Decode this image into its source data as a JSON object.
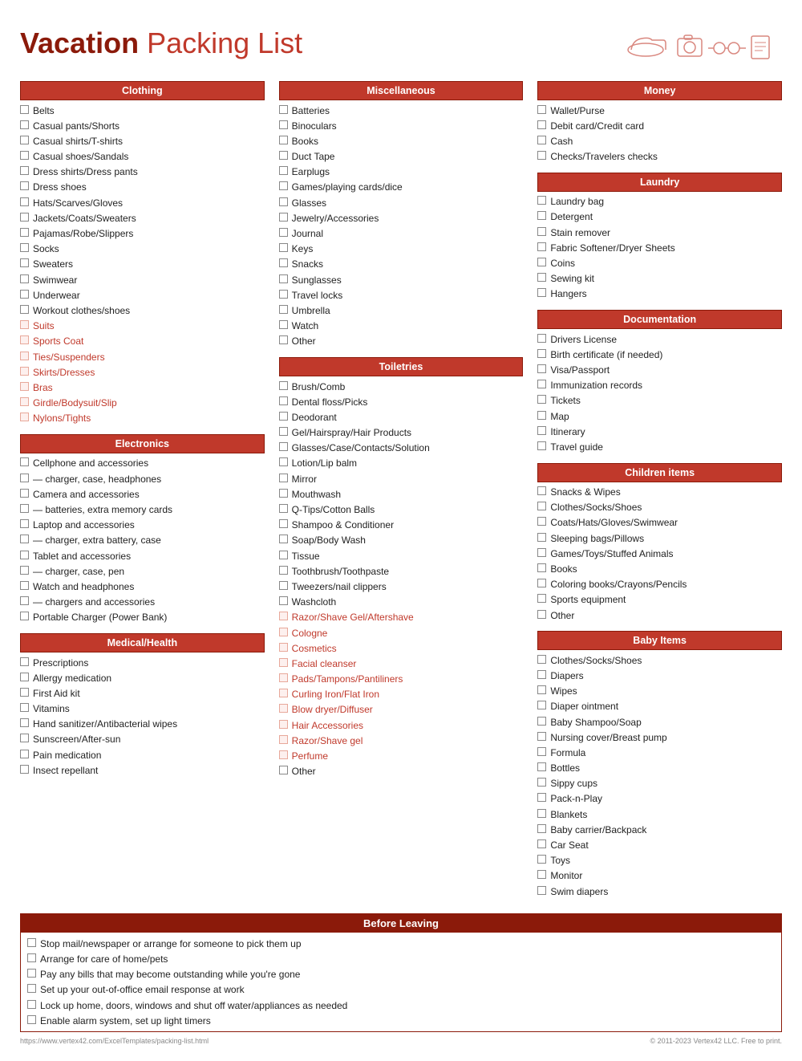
{
  "header": {
    "title_bold": "Vacation",
    "title_rest": " Packing List",
    "icons": "✈ 👟 📷 👓"
  },
  "columns": [
    {
      "sections": [
        {
          "id": "clothing",
          "label": "Clothing",
          "style": "dark",
          "items": [
            {
              "text": "Belts",
              "pink": false
            },
            {
              "text": "Casual pants/Shorts",
              "pink": false
            },
            {
              "text": "Casual shirts/T-shirts",
              "pink": false
            },
            {
              "text": "Casual shoes/Sandals",
              "pink": false
            },
            {
              "text": "Dress shirts/Dress pants",
              "pink": false
            },
            {
              "text": "Dress shoes",
              "pink": false
            },
            {
              "text": "Hats/Scarves/Gloves",
              "pink": false
            },
            {
              "text": "Jackets/Coats/Sweaters",
              "pink": false
            },
            {
              "text": "Pajamas/Robe/Slippers",
              "pink": false
            },
            {
              "text": "Socks",
              "pink": false
            },
            {
              "text": "Sweaters",
              "pink": false
            },
            {
              "text": "Swimwear",
              "pink": false
            },
            {
              "text": "Underwear",
              "pink": false
            },
            {
              "text": "Workout clothes/shoes",
              "pink": false
            },
            {
              "text": "Suits",
              "pink": true
            },
            {
              "text": "Sports Coat",
              "pink": true
            },
            {
              "text": "Ties/Suspenders",
              "pink": true
            },
            {
              "text": "Skirts/Dresses",
              "pink": true
            },
            {
              "text": "Bras",
              "pink": true
            },
            {
              "text": "Girdle/Bodysuit/Slip",
              "pink": true
            },
            {
              "text": "Nylons/Tights",
              "pink": true
            }
          ]
        },
        {
          "id": "electronics",
          "label": "Electronics",
          "style": "dark",
          "items": [
            {
              "text": "Cellphone and accessories",
              "pink": false
            },
            {
              "text": "— charger, case, headphones",
              "pink": false
            },
            {
              "text": "Camera and accessories",
              "pink": false
            },
            {
              "text": "— batteries, extra memory cards",
              "pink": false
            },
            {
              "text": "Laptop and accessories",
              "pink": false
            },
            {
              "text": "— charger, extra battery, case",
              "pink": false
            },
            {
              "text": "Tablet and accessories",
              "pink": false
            },
            {
              "text": "— charger, case, pen",
              "pink": false
            },
            {
              "text": "Watch and headphones",
              "pink": false
            },
            {
              "text": "— chargers and accessories",
              "pink": false
            },
            {
              "text": "Portable Charger (Power Bank)",
              "pink": false
            }
          ]
        },
        {
          "id": "medical",
          "label": "Medical/Health",
          "style": "dark",
          "items": [
            {
              "text": "Prescriptions",
              "pink": false
            },
            {
              "text": "Allergy medication",
              "pink": false
            },
            {
              "text": "First Aid kit",
              "pink": false
            },
            {
              "text": "Vitamins",
              "pink": false
            },
            {
              "text": "Hand sanitizer/Antibacterial wipes",
              "pink": false
            },
            {
              "text": "Sunscreen/After-sun",
              "pink": false
            },
            {
              "text": "Pain medication",
              "pink": false
            },
            {
              "text": "Insect repellant",
              "pink": false
            }
          ]
        }
      ]
    },
    {
      "sections": [
        {
          "id": "miscellaneous",
          "label": "Miscellaneous",
          "style": "dark",
          "items": [
            {
              "text": "Batteries",
              "pink": false
            },
            {
              "text": "Binoculars",
              "pink": false
            },
            {
              "text": "Books",
              "pink": false
            },
            {
              "text": "Duct Tape",
              "pink": false
            },
            {
              "text": "Earplugs",
              "pink": false
            },
            {
              "text": "Games/playing cards/dice",
              "pink": false
            },
            {
              "text": "Glasses",
              "pink": false
            },
            {
              "text": "Jewelry/Accessories",
              "pink": false
            },
            {
              "text": "Journal",
              "pink": false
            },
            {
              "text": "Keys",
              "pink": false
            },
            {
              "text": "Snacks",
              "pink": false
            },
            {
              "text": "Sunglasses",
              "pink": false
            },
            {
              "text": "Travel locks",
              "pink": false
            },
            {
              "text": "Umbrella",
              "pink": false
            },
            {
              "text": "Watch",
              "pink": false
            },
            {
              "text": "Other",
              "pink": false
            }
          ]
        },
        {
          "id": "toiletries",
          "label": "Toiletries",
          "style": "dark",
          "items": [
            {
              "text": "Brush/Comb",
              "pink": false
            },
            {
              "text": "Dental floss/Picks",
              "pink": false
            },
            {
              "text": "Deodorant",
              "pink": false
            },
            {
              "text": "Gel/Hairspray/Hair Products",
              "pink": false
            },
            {
              "text": "Glasses/Case/Contacts/Solution",
              "pink": false
            },
            {
              "text": "Lotion/Lip balm",
              "pink": false
            },
            {
              "text": "Mirror",
              "pink": false
            },
            {
              "text": "Mouthwash",
              "pink": false
            },
            {
              "text": "Q-Tips/Cotton Balls",
              "pink": false
            },
            {
              "text": "Shampoo & Conditioner",
              "pink": false
            },
            {
              "text": "Soap/Body Wash",
              "pink": false
            },
            {
              "text": "Tissue",
              "pink": false
            },
            {
              "text": "Toothbrush/Toothpaste",
              "pink": false
            },
            {
              "text": "Tweezers/nail clippers",
              "pink": false
            },
            {
              "text": "Washcloth",
              "pink": false
            },
            {
              "text": "Razor/Shave Gel/Aftershave",
              "pink": true
            },
            {
              "text": "Cologne",
              "pink": true
            },
            {
              "text": "Cosmetics",
              "pink": true
            },
            {
              "text": "Facial cleanser",
              "pink": true
            },
            {
              "text": "Pads/Tampons/Pantiliners",
              "pink": true
            },
            {
              "text": "Curling Iron/Flat Iron",
              "pink": true
            },
            {
              "text": "Blow dryer/Diffuser",
              "pink": true
            },
            {
              "text": "Hair Accessories",
              "pink": true
            },
            {
              "text": "Razor/Shave gel",
              "pink": true
            },
            {
              "text": "Perfume",
              "pink": true
            },
            {
              "text": "Other",
              "pink": false
            }
          ]
        }
      ]
    },
    {
      "sections": [
        {
          "id": "money",
          "label": "Money",
          "style": "dark",
          "items": [
            {
              "text": "Wallet/Purse",
              "pink": false
            },
            {
              "text": "Debit card/Credit card",
              "pink": false
            },
            {
              "text": "Cash",
              "pink": false
            },
            {
              "text": "Checks/Travelers checks",
              "pink": false
            }
          ]
        },
        {
          "id": "laundry",
          "label": "Laundry",
          "style": "dark",
          "items": [
            {
              "text": "Laundry bag",
              "pink": false
            },
            {
              "text": "Detergent",
              "pink": false
            },
            {
              "text": "Stain remover",
              "pink": false
            },
            {
              "text": "Fabric Softener/Dryer Sheets",
              "pink": false
            },
            {
              "text": "Coins",
              "pink": false
            },
            {
              "text": "Sewing kit",
              "pink": false
            },
            {
              "text": "Hangers",
              "pink": false
            }
          ]
        },
        {
          "id": "documentation",
          "label": "Documentation",
          "style": "dark",
          "items": [
            {
              "text": "Drivers License",
              "pink": false
            },
            {
              "text": "Birth certificate (if needed)",
              "pink": false
            },
            {
              "text": "Visa/Passport",
              "pink": false
            },
            {
              "text": "Immunization records",
              "pink": false
            },
            {
              "text": "Tickets",
              "pink": false
            },
            {
              "text": "Map",
              "pink": false
            },
            {
              "text": "Itinerary",
              "pink": false
            },
            {
              "text": "Travel guide",
              "pink": false
            }
          ]
        },
        {
          "id": "children",
          "label": "Children items",
          "style": "dark",
          "items": [
            {
              "text": "Snacks & Wipes",
              "pink": false
            },
            {
              "text": "Clothes/Socks/Shoes",
              "pink": false
            },
            {
              "text": "Coats/Hats/Gloves/Swimwear",
              "pink": false
            },
            {
              "text": "Sleeping bags/Pillows",
              "pink": false
            },
            {
              "text": "Games/Toys/Stuffed Animals",
              "pink": false
            },
            {
              "text": "Books",
              "pink": false
            },
            {
              "text": "Coloring books/Crayons/Pencils",
              "pink": false
            },
            {
              "text": "Sports equipment",
              "pink": false
            },
            {
              "text": "Other",
              "pink": false
            }
          ]
        },
        {
          "id": "baby",
          "label": "Baby Items",
          "style": "dark",
          "items": [
            {
              "text": "Clothes/Socks/Shoes",
              "pink": false
            },
            {
              "text": "Diapers",
              "pink": false
            },
            {
              "text": "Wipes",
              "pink": false
            },
            {
              "text": "Diaper ointment",
              "pink": false
            },
            {
              "text": "Baby Shampoo/Soap",
              "pink": false
            },
            {
              "text": "Nursing cover/Breast pump",
              "pink": false
            },
            {
              "text": "Formula",
              "pink": false
            },
            {
              "text": "Bottles",
              "pink": false
            },
            {
              "text": "Sippy cups",
              "pink": false
            },
            {
              "text": "Pack-n-Play",
              "pink": false
            },
            {
              "text": "Blankets",
              "pink": false
            },
            {
              "text": "Baby carrier/Backpack",
              "pink": false
            },
            {
              "text": "Car Seat",
              "pink": false
            },
            {
              "text": "Toys",
              "pink": false
            },
            {
              "text": "Monitor",
              "pink": false
            },
            {
              "text": "Swim diapers",
              "pink": false
            }
          ]
        }
      ]
    }
  ],
  "before_leaving": {
    "label": "Before Leaving",
    "items": [
      "Stop mail/newspaper or arrange for someone to pick them up",
      "Arrange for care of home/pets",
      "Pay any bills that may become outstanding while you're gone",
      "Set up your out-of-office email response at work",
      "Lock up home, doors, windows and shut off water/appliances as needed",
      "Enable alarm system, set up light timers"
    ]
  },
  "footer": {
    "left": "https://www.vertex42.com/ExcelTemplates/packing-list.html",
    "right": "© 2011-2023 Vertex42 LLC. Free to print."
  }
}
